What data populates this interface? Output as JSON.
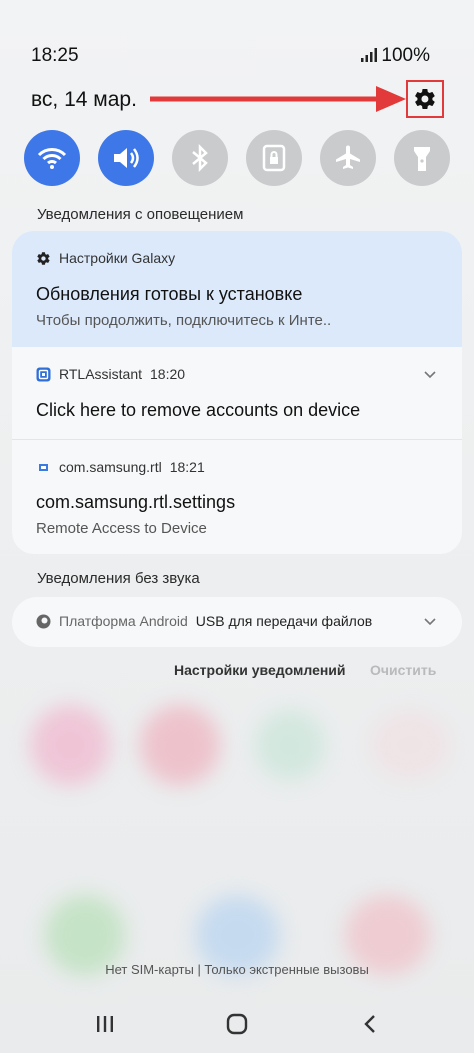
{
  "status_bar": {
    "time": "18:25",
    "battery": "100%",
    "signal_icon": "signal-icon"
  },
  "header": {
    "date": "вс, 14 мар.",
    "settings_icon": "gear-icon"
  },
  "quick_tiles": [
    {
      "name": "wifi-icon",
      "state": "on"
    },
    {
      "name": "sound-icon",
      "state": "on"
    },
    {
      "name": "bluetooth-icon",
      "state": "off"
    },
    {
      "name": "rotation-lock-icon",
      "state": "off"
    },
    {
      "name": "airplane-icon",
      "state": "off"
    },
    {
      "name": "flashlight-icon",
      "state": "off"
    }
  ],
  "alerting_section": {
    "label": "Уведомления с оповещением",
    "notifications": [
      {
        "app": "Настройки Galaxy",
        "title": "Обновления готовы к установке",
        "body": "Чтобы продолжить, подключитесь к Инте.."
      },
      {
        "app": "RTLAssistant",
        "time": "18:20",
        "title": "Click here to remove accounts on device"
      },
      {
        "app": "com.samsung.rtl",
        "time": "18:21",
        "title": "com.samsung.rtl.settings",
        "body": "Remote Access to Device"
      }
    ]
  },
  "silent_section": {
    "label": "Уведомления без звука",
    "notification": {
      "app": "Платформа Android",
      "text": "USB для передачи файлов"
    }
  },
  "actions": {
    "settings_label": "Настройки уведомлений",
    "clear_label": "Очистить"
  },
  "footer": {
    "sim_status": "Нет SIM-карты | Только экстренные вызовы"
  },
  "colors": {
    "accent": "#3e78e8",
    "highlight": "#dbe9fb",
    "annotation_red": "#e23a3a"
  }
}
